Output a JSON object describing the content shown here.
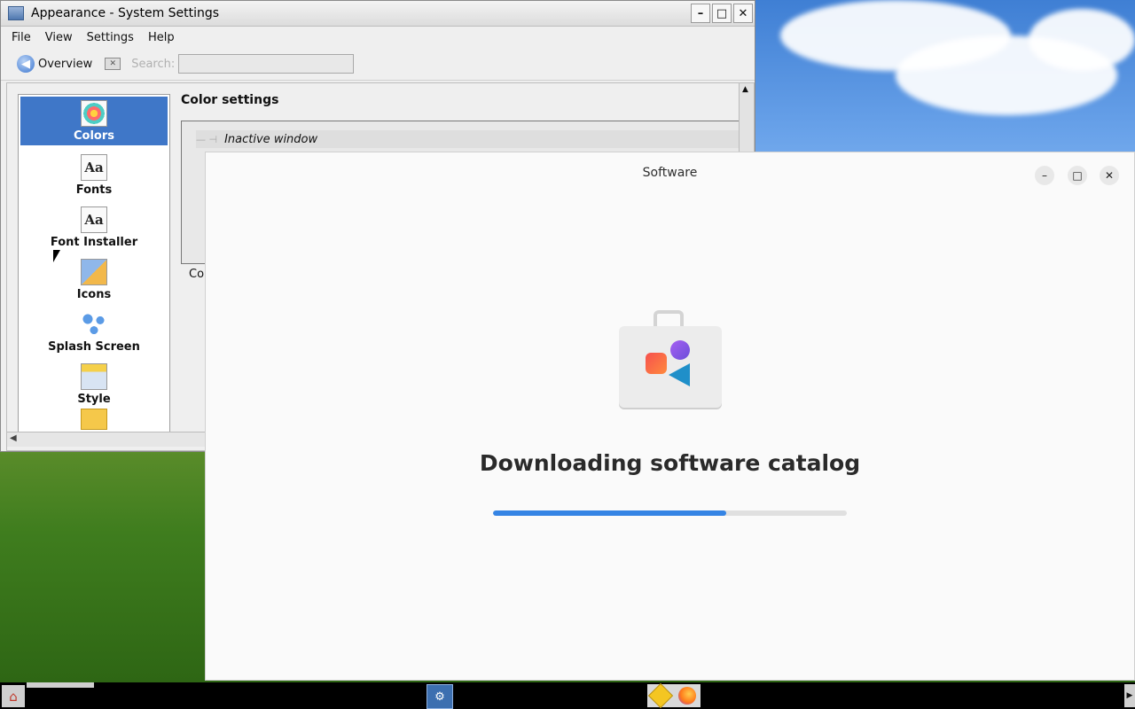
{
  "kde_window": {
    "title": "Appearance - System Settings",
    "buttons": {
      "minimize": "–",
      "maximize": "□",
      "close": "✕"
    },
    "menu": [
      "File",
      "View",
      "Settings",
      "Help"
    ],
    "toolbar": {
      "overview_label": "Overview",
      "search_label": "Search:",
      "search_value": ""
    },
    "sidebar_items": [
      "Colors",
      "Fonts",
      "Font Installer",
      "Icons",
      "Splash Screen",
      "Style"
    ],
    "sidebar_icons": {
      "fonts_glyph": "Aa",
      "font_installer_glyph": "Aa"
    },
    "content_title": "Color settings",
    "inactive_window_label": "Inactive window",
    "colors_group_label_partial": "Col"
  },
  "software_window": {
    "title": "Software",
    "buttons": {
      "minimize": "–",
      "maximize": "□",
      "close": "✕"
    },
    "status_heading": "Downloading software catalog",
    "progress_fraction": 0.66
  }
}
